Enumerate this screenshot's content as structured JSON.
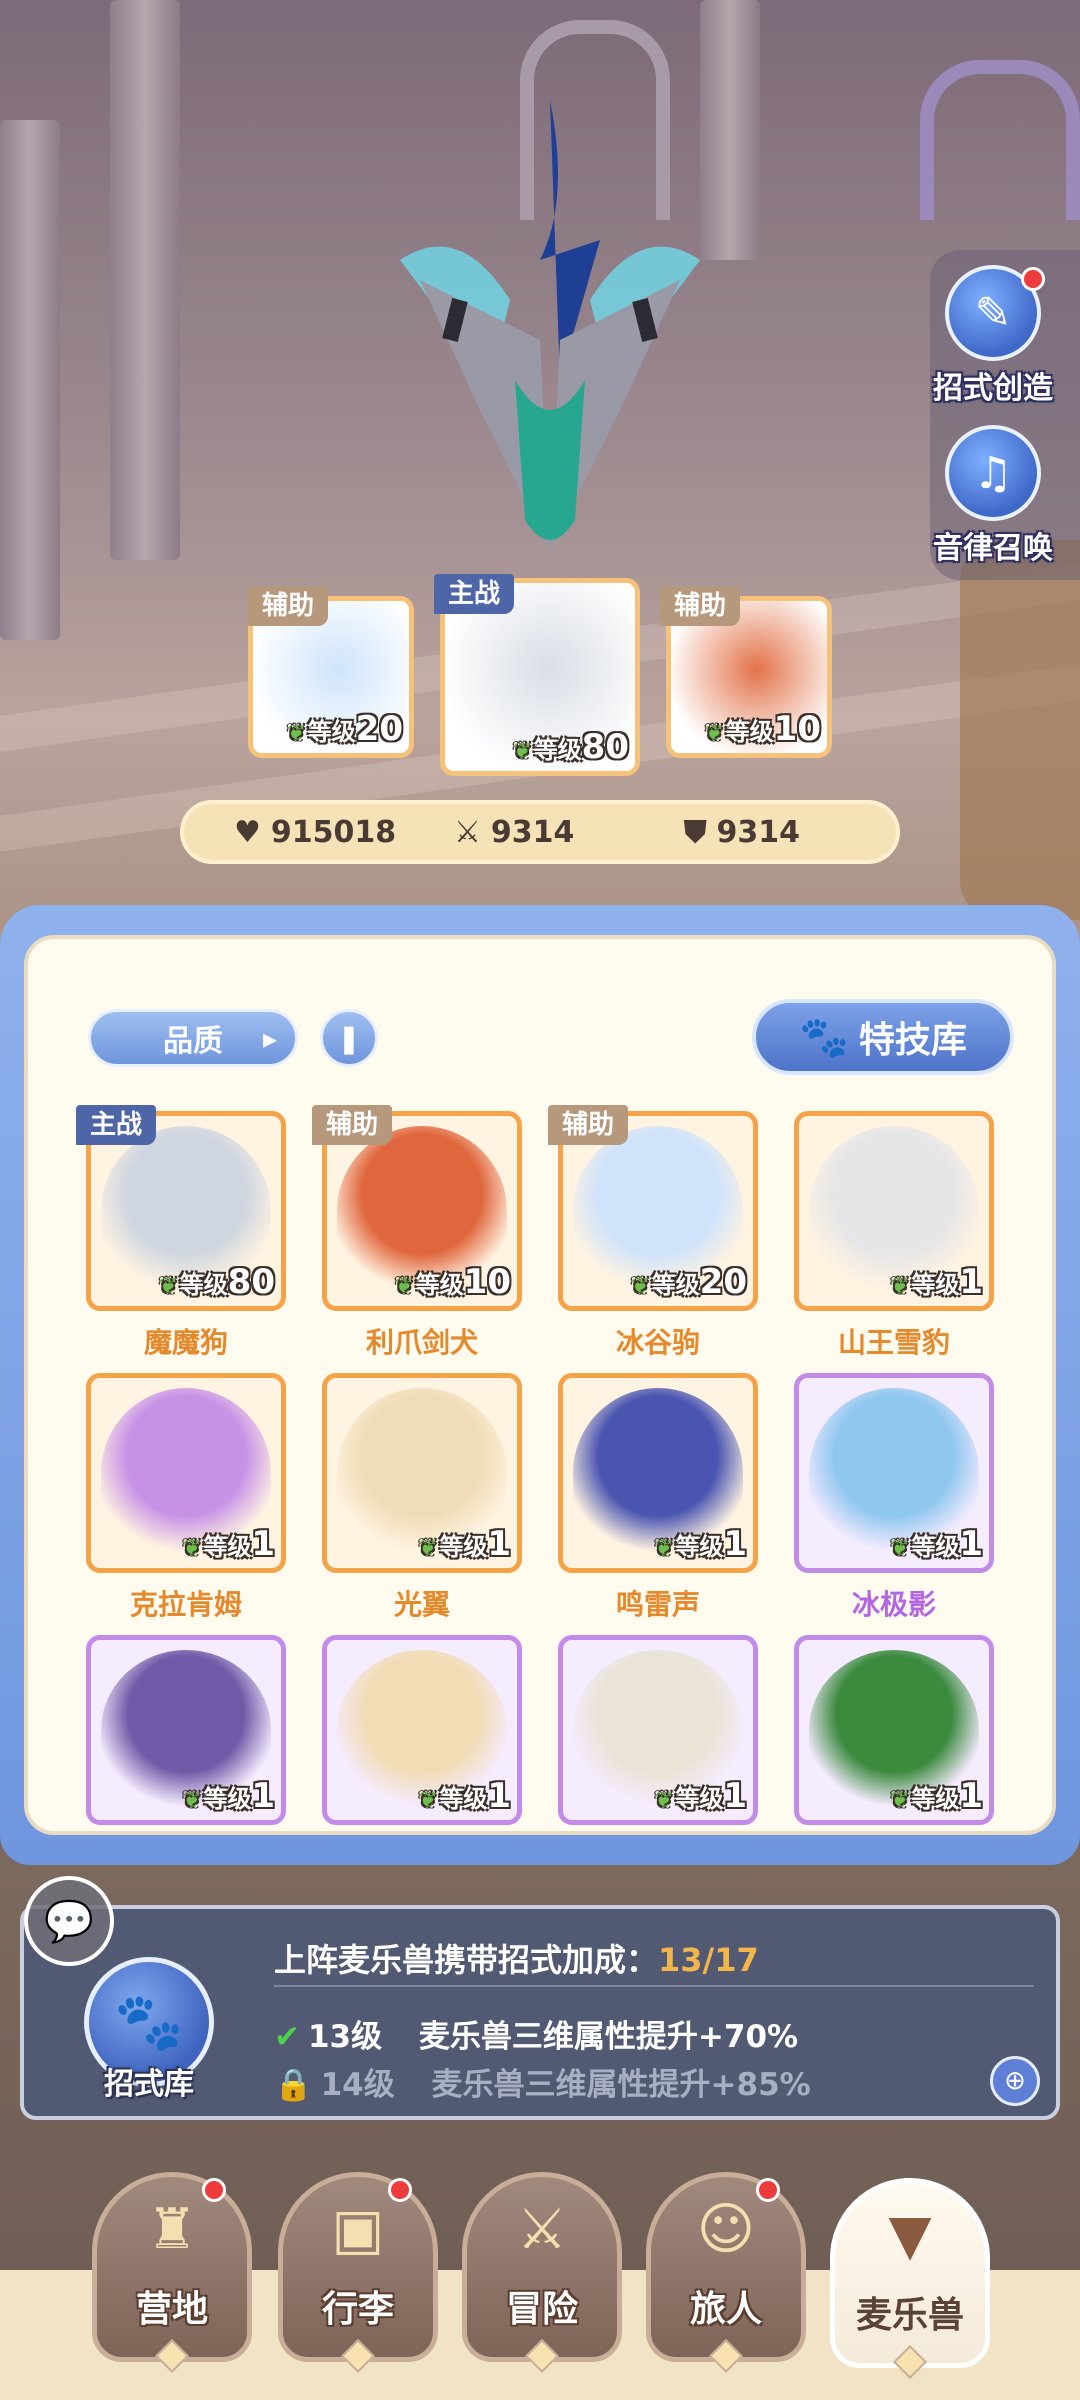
{
  "side_buttons": [
    {
      "label": "招式创造",
      "icon": "scroll-cat-icon",
      "badge": true
    },
    {
      "label": "音律召唤",
      "icon": "lyre-icon",
      "badge": false
    }
  ],
  "team": [
    {
      "role": "辅助",
      "level_key": "等级",
      "level": "20",
      "frame": "orange",
      "art_color": "#cfe4fb"
    },
    {
      "role": "主战",
      "level_key": "等级",
      "level": "80",
      "frame": "orange",
      "art_color": "#d9dee6"
    },
    {
      "role": "辅助",
      "level_key": "等级",
      "level": "10",
      "frame": "orange",
      "art_color": "#e2734a"
    }
  ],
  "stats": {
    "hp": "915018",
    "hp_icon": "heart-icon",
    "attack": "9314",
    "attack_icon": "crossed-swords-icon",
    "defense": "9314",
    "defense_icon": "shield-icon"
  },
  "toolbar": {
    "filter_label": "品质",
    "book_icon": "book-icon",
    "skill_library_label": "特技库"
  },
  "pets": [
    {
      "name": "魔魔狗",
      "role": "主战",
      "level_key": "等级",
      "level": "80",
      "rarity": "orange",
      "art_color": "#cfd6e0"
    },
    {
      "name": "利爪剑犬",
      "role": "辅助",
      "level_key": "等级",
      "level": "10",
      "rarity": "orange",
      "art_color": "#e0673d"
    },
    {
      "name": "冰谷驹",
      "role": "辅助",
      "level_key": "等级",
      "level": "20",
      "rarity": "orange",
      "art_color": "#cfe3fb"
    },
    {
      "name": "山王雪豹",
      "role": "",
      "level_key": "等级",
      "level": "1",
      "rarity": "orange",
      "art_color": "#e6e6e8"
    },
    {
      "name": "克拉肯姆",
      "role": "",
      "level_key": "等级",
      "level": "1",
      "rarity": "orange",
      "art_color": "#c792e6"
    },
    {
      "name": "光翼",
      "role": "",
      "level_key": "等级",
      "level": "1",
      "rarity": "orange",
      "art_color": "#f0dcb6"
    },
    {
      "name": "鸣雷声",
      "role": "",
      "level_key": "等级",
      "level": "1",
      "rarity": "orange",
      "art_color": "#4a55b0"
    },
    {
      "name": "冰极影",
      "role": "",
      "level_key": "等级",
      "level": "1",
      "rarity": "purple",
      "art_color": "#8fc7ef"
    },
    {
      "name": "",
      "role": "",
      "level_key": "等级",
      "level": "1",
      "rarity": "purple",
      "art_color": "#6e5aa6"
    },
    {
      "name": "",
      "role": "",
      "level_key": "等级",
      "level": "1",
      "rarity": "purple",
      "art_color": "#f1dcb5"
    },
    {
      "name": "",
      "role": "",
      "level_key": "等级",
      "level": "1",
      "rarity": "purple",
      "art_color": "#e9e4d6"
    },
    {
      "name": "",
      "role": "",
      "level_key": "等级",
      "level": "1",
      "rarity": "purple",
      "art_color": "#3b8a3e"
    }
  ],
  "bonus": {
    "title": "上阵麦乐兽携带招式加成：",
    "count": "13/17",
    "active_level": "13级",
    "active_text": "麦乐兽三维属性提升+70%",
    "locked_level": "14级",
    "locked_text": "麦乐兽三维属性提升+85%",
    "skill_base_label": "招式库"
  },
  "nav": [
    {
      "label": "营地",
      "icon": "castle-icon",
      "badge": true,
      "active": false
    },
    {
      "label": "行李",
      "icon": "backpack-icon",
      "badge": true,
      "active": false
    },
    {
      "label": "冒险",
      "icon": "crossed-swords-icon",
      "badge": false,
      "active": false
    },
    {
      "label": "旅人",
      "icon": "traveler-icon",
      "badge": true,
      "active": false
    },
    {
      "label": "麦乐兽",
      "icon": "fox-head-icon",
      "badge": false,
      "active": true
    }
  ]
}
